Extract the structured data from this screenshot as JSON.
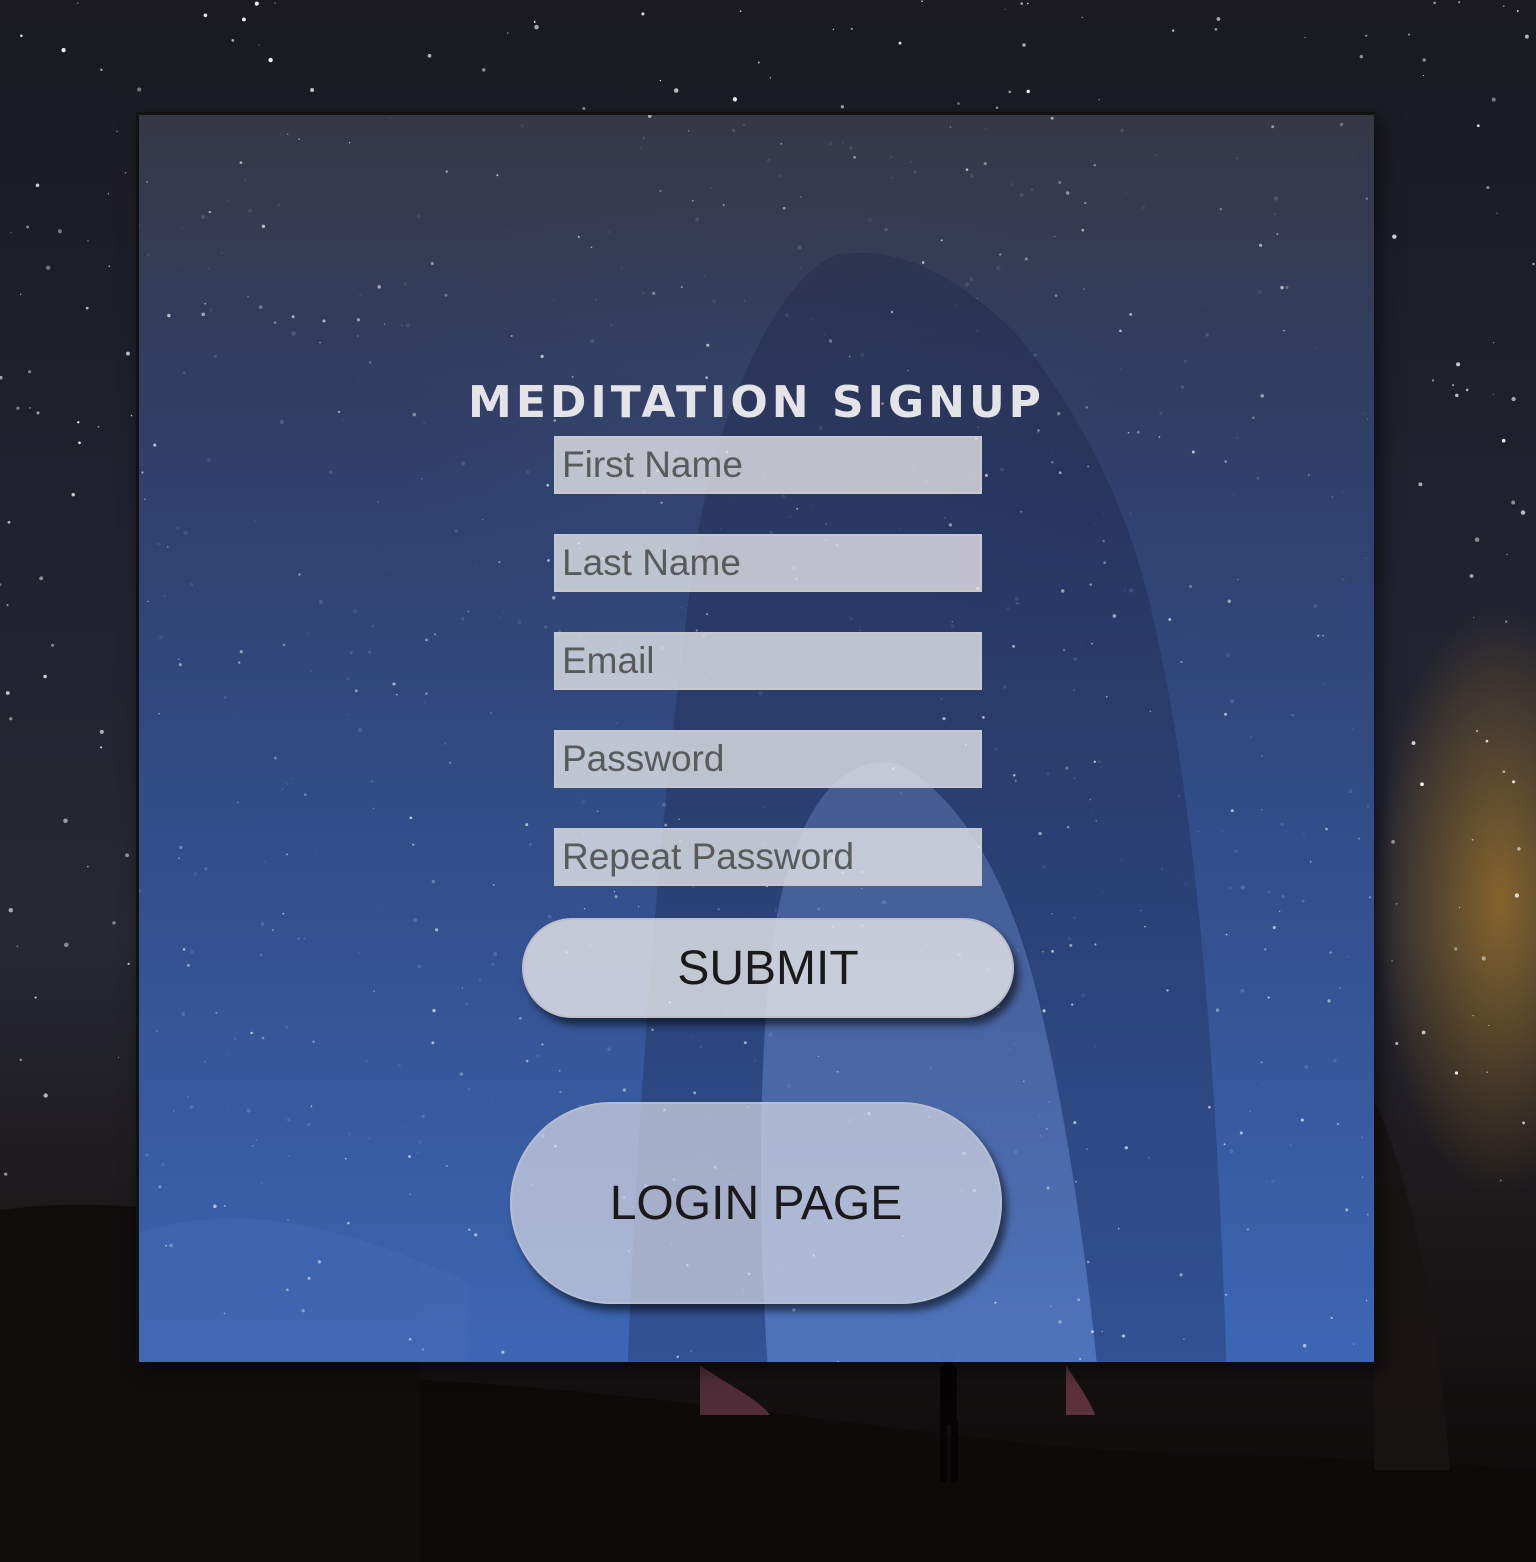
{
  "page": {
    "title": "MEDITATION SIGNUP"
  },
  "form": {
    "fields": [
      {
        "placeholder": "First Name",
        "value": ""
      },
      {
        "placeholder": "Last Name",
        "value": ""
      },
      {
        "placeholder": "Email",
        "value": ""
      },
      {
        "placeholder": "Password",
        "value": ""
      },
      {
        "placeholder": "Repeat Password",
        "value": ""
      }
    ],
    "submit_label": "SUBMIT"
  },
  "login": {
    "label": "LOGIN PAGE"
  },
  "colors": {
    "panel_top": "#3a3c4b",
    "panel_bottom": "#406ec3",
    "title_text": "#e4e4e8",
    "button_bg": "#e4e4e8",
    "button_text": "#1a1a1a"
  }
}
